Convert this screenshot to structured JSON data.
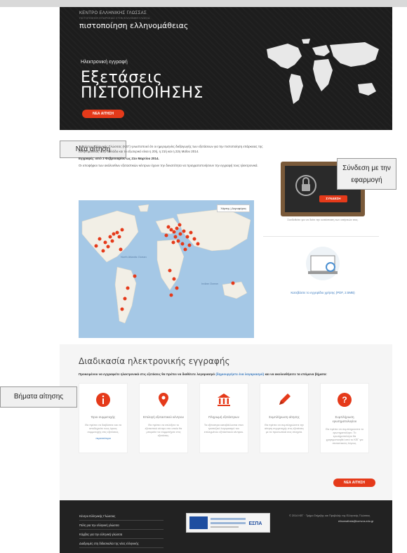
{
  "hero": {
    "brand_small": "ΚΕΝΤΡΟ ΕΛΛΗΝΙΚΗΣ ΓΛΩΣΣΑΣ",
    "brand_small2": "ΠΙΣΤΟΠΟΙΗΣΗ ΕΠΑΡΚΕΙΑΣ ΣΤΗΝ ΕΛΛΗΝΙΚΗ ΓΛΩΣΣΑ",
    "brand_big": "πιστοποίηση ελληνομάθειας",
    "subtitle": "Ηλεκτρονική εγγραφή",
    "title_line1": "Εξετάσεις",
    "title_line2": "ΠΙΣΤΟΠΟΙΗΣΗΣ",
    "button": "ΝΕΑ ΑΙΤΗΣΗ"
  },
  "callouts": {
    "new_application": "Νέα αίτηση",
    "login": "Σύνδεση με την εφαρμογή",
    "steps": "Βήματα αίτησης"
  },
  "intro": {
    "line1": "Το Κέντρο Ελληνικής Γλώσσας (ΚΕΓ) γνωστοποιεί ότι οι ημερομηνίες διεξαγωγής των εξετάσεων για την πιστοποίηση επάρκειας της ελληνομάθειας στην Ελλάδα και το εξωτερικό είναι η 20ή, η 21ή και η 22η Μαΐου 2014.",
    "line2": "Εγγραφές: από 3 Φεβρουαρίου ως 21ο Μαρτίου 2014.",
    "line3": "Οι υποψήφιοι των ακόλουθων εξεταστικών κέντρων έχουν την δυνατότητα να πραγματοποιήσουν την εγγραφή τους ηλεκτρονικά."
  },
  "map": {
    "controls": "Χάρτης | Δορυφόρος",
    "label_atlantic": "North Atlantic Ocean",
    "label_indian": "Indian Ocean"
  },
  "login": {
    "button": "ΣΥΝΔΕΣΗ",
    "note": "Συνδεθείτε για να δείτε την κατάσταση των αιτήσεών σας."
  },
  "manual": {
    "text": "Κατεβάστε το εγχειρίδιο χρήσης (PDF, 2.5MB)"
  },
  "steps": {
    "title": "Διαδικασία ηλεκτρονικής εγγραφής",
    "intro_start": "Προκειμένου να εγγραφείτε ηλεκτρονικά στις εξετάσεις θα πρέπει να διαθέτετε λογαριασμό ",
    "intro_link": "(δημιουργήστε ένα λογαριασμό)",
    "intro_end": " και να ακολουθήσετε τα επόμενα βήματα:",
    "items": [
      {
        "title": "Όροι συμμετοχής",
        "desc": "Θα πρέπει να διαβάσετε και να αποδεχτείτε τους όρους συμμετοχής στις εξετάσεις.",
        "link": "περισσότερα"
      },
      {
        "title": "Επιλογή εξεταστικού κέντρου",
        "desc": "Θα πρέπει να επιλέξετε το εξεταστικό κέντρο στο οποίο θα μπορείτε να συμμετέχετε στις εξετάσεις.",
        "link": ""
      },
      {
        "title": "Πληρωμή εξετάστρων",
        "desc": "Τα εξέταστρα καταβάλλονται στον τραπεζικό λογαριασμό του επιλεγμένου εξεταστικού κέντρου.",
        "link": ""
      },
      {
        "title": "Συμπλήρωση αίτησης",
        "desc": "Θα πρέπει να συμπληρώσετε την αίτηση συμμετοχής στις εξετάσεις με τα προσωπικά σας στοιχεία.",
        "link": ""
      },
      {
        "title": "Συμπλήρωση ερωτηματολογίου",
        "desc": "Θα πρέπει να συμπληρώσετε το ερωτηματολόγιο. Το ερωτηματολόγιο θα χρησιμοποιηθεί από το ΚΕΓ για στατιστικούς λόγους.",
        "link": ""
      }
    ],
    "bottom_button": "ΝΕΑ ΑΙΤΗΣΗ"
  },
  "footer": {
    "links": [
      "Κέντρο Ελληνικής Γλώσσας",
      "Πύλη για την ελληνική γλώσσα",
      "Κόμβος για την ελληνική γλώσσα",
      "Διαδρομές στη διδασκαλία της νέας ελληνικής"
    ],
    "banner_text": "ΕΣΠΑ",
    "copyright": "© 2014 ΚΕΓ · Τμήμα Στήριξης και Προβολής της Ελληνικής Γλώσσας",
    "email": "elinomatheia@komvos.edu.gr"
  },
  "colors": {
    "accent": "#e53a1a",
    "hero_bg": "#1d1d1d",
    "link": "#3b7bbf"
  }
}
